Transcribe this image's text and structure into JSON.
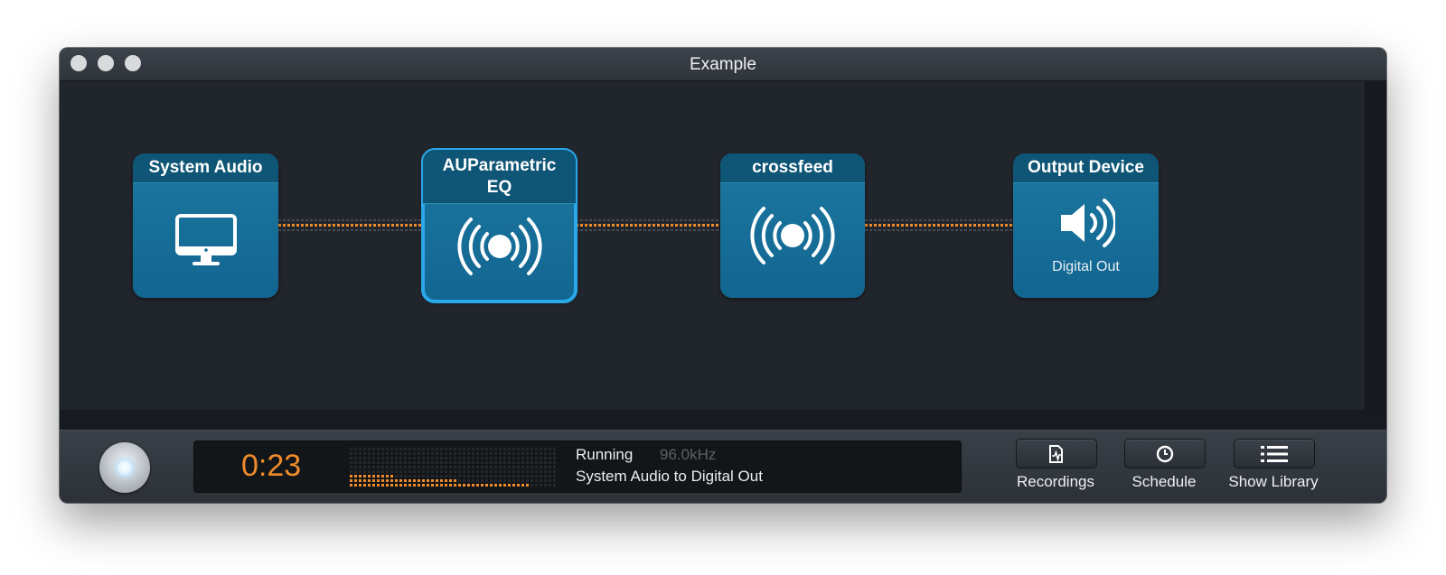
{
  "window": {
    "title": "Example"
  },
  "nodes": [
    {
      "title": "System Audio",
      "icon": "monitor-icon",
      "subtitle": ""
    },
    {
      "title_line1": "AUParametric",
      "title_line2": "EQ",
      "icon": "broadcast-icon",
      "selected": true
    },
    {
      "title": "crossfeed",
      "icon": "broadcast-icon"
    },
    {
      "title": "Output Device",
      "icon": "speaker-icon",
      "subtitle": "Digital Out"
    }
  ],
  "status": {
    "time": "0:23",
    "state": "Running",
    "sample_rate": "96.0kHz",
    "route": "System Audio to Digital Out"
  },
  "toolbar": {
    "recordings_label": "Recordings",
    "schedule_label": "Schedule",
    "show_library_label": "Show Library"
  },
  "colors": {
    "accent_orange": "#f08b2c",
    "node_blue": "#1c78a0",
    "selected_outline": "#2aa8ea"
  }
}
